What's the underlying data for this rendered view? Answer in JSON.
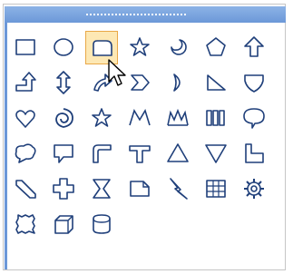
{
  "palette": {
    "title_grip": "",
    "selected_shape": "rounded-rectangle",
    "accent_color": "#6c98d8",
    "shape_fill": "#ffffff",
    "shape_stroke": "#1f3f7a",
    "rows": [
      [
        "rectangle",
        "ellipse",
        "rounded-rectangle",
        "star-5",
        "moon-swirl",
        "pentagon",
        "up-arrow"
      ],
      [
        "bent-up-arrow",
        "up-down-arrow",
        "curved-arrow",
        "chevron",
        "half-circle",
        "triangle-corner",
        "shield"
      ],
      [
        "heart",
        "swirl",
        "star-outline",
        "zigzag-m",
        "zigzag-double",
        "bars",
        "speech-bubble-oval"
      ],
      [
        "thought-bubble",
        "speech-bubble-rect",
        "corner-shape",
        "t-shape",
        "triangle-up",
        "triangle-down",
        "l-shape"
      ],
      [
        "diagonal-slash",
        "plus-cross",
        "hourglass",
        "folded-corner",
        "lightning",
        "table-grid",
        "gear"
      ],
      [
        "frame",
        "cube",
        "cylinder"
      ]
    ]
  }
}
